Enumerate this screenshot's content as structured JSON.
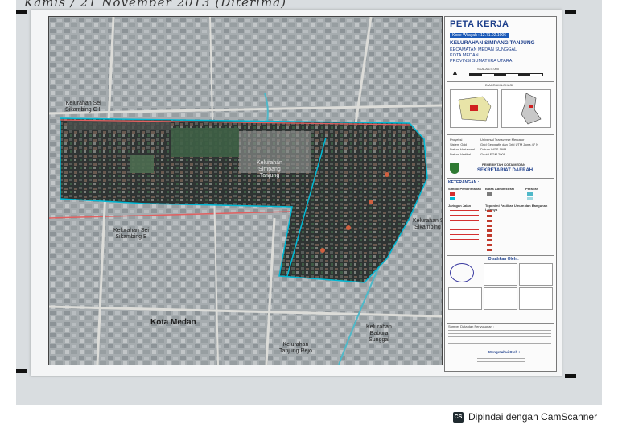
{
  "header": {
    "handwritten_note": "Kamis / 21 November 2013 (Diterima)"
  },
  "map": {
    "labels": {
      "sei_sikambing_cii": "Kelurahan Sei\nSikambing C II",
      "simpang_tanjung": "Kelurahan\nSimpang\nTanjung",
      "sei_sikambing_d": "Kelurahan Sei\nSikambing D",
      "sei_sikambing_b": "Kelurahan Sei\nSikambing B",
      "kota_medan": "Kota Medan",
      "babura_sunggal": "Kelurahan\nBabura\nSunggal",
      "tanjung_rejo": "Kelurahan\nTanjung Rejo"
    }
  },
  "legend": {
    "title": "PETA KERJA",
    "code": "Kode Wilayah : 12.71.02.1006",
    "kelurahan": "KELURAHAN SIMPANG TANJUNG",
    "kecamatan": "KECAMATAN MEDAN SUNGGAL",
    "kota": "KOTA MEDAN",
    "provinsi": "PROVINSI SUMATERA UTARA",
    "scale": "SKALA 1:5.000",
    "inset_title": "DIAGRAM LOKASI",
    "projection_lines": [
      "Proyeksi",
      "Sistem Grid",
      "Datum Horizontal",
      "Datum Vertikal"
    ],
    "projection_values": [
      "Universal Transverse Mercator",
      "Grid Geografis dan Grid UTM Zona 47 N",
      "Datum WGS 1984",
      "Geoid EGM 2008"
    ],
    "pemkot": "PEMERINTAH KOTA MEDAN",
    "sekretariat": "SEKRETARIAT DAERAH",
    "keterangan": "KETERANGAN :",
    "legend_heads": [
      "Simbol Pemerintahan",
      "Batas Administrasi",
      "Perairan",
      "Jaringan Jalan",
      "Toponimi Fasilitas Umum dan Bangunan Lainnya"
    ],
    "disahkan": "Disahkan Oleh :",
    "mengetahui": "Mengetahui Oleh :",
    "sumber": "Sumber Data dan Penyusunan :"
  },
  "colors": {
    "boundary": "#00b8d4",
    "river": "#4fb8c8",
    "road_red": "#d43030",
    "title_blue": "#1b3d8a"
  },
  "footer": {
    "camscanner": "Dipindai dengan CamScanner",
    "cs_icon": "CS"
  }
}
